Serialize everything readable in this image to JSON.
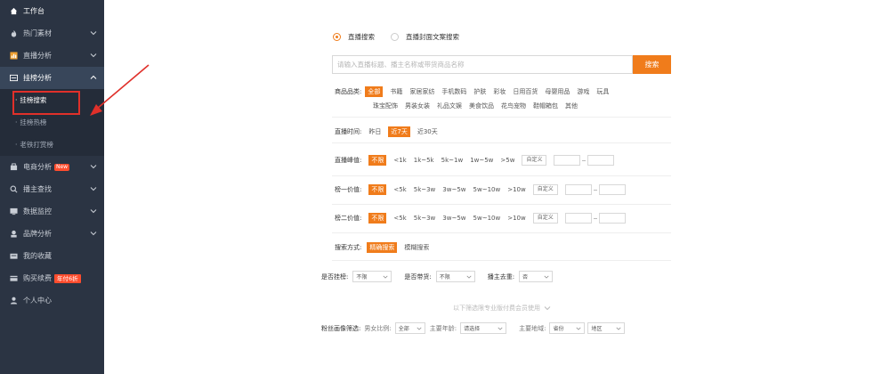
{
  "sidebar": {
    "items": [
      {
        "label": "工作台",
        "icon": "home-icon"
      },
      {
        "label": "热门素材",
        "icon": "fire-icon"
      },
      {
        "label": "直播分析",
        "icon": "bar-chart-icon"
      },
      {
        "label": "挂榜分析",
        "icon": "board-icon"
      },
      {
        "label": "电商分析",
        "icon": "shop-icon",
        "badge": "New"
      },
      {
        "label": "播主查找",
        "icon": "search-icon"
      },
      {
        "label": "数据监控",
        "icon": "monitor-icon"
      },
      {
        "label": "品牌分析",
        "icon": "brand-icon"
      },
      {
        "label": "我的收藏",
        "icon": "folder-icon"
      },
      {
        "label": "购买续费",
        "icon": "card-icon",
        "badge": "年付6折"
      },
      {
        "label": "个人中心",
        "icon": "user-icon"
      }
    ],
    "subitems": [
      {
        "label": "挂榜搜索"
      },
      {
        "label": "挂榜热榜"
      },
      {
        "label": "老铁打赏榜"
      }
    ]
  },
  "search": {
    "modes": [
      "直播搜索",
      "直播封面文案搜索"
    ],
    "placeholder": "请输入直播标题、播主名称或带货商品名称",
    "button": "搜索"
  },
  "filters": {
    "category": {
      "label": "商品品类:",
      "row1": [
        "全部",
        "书籍",
        "家居家纺",
        "手机数码",
        "护肤",
        "彩妆",
        "日用百货",
        "母婴用品",
        "游戏",
        "玩具"
      ],
      "row2": [
        "珠宝配饰",
        "男装女装",
        "礼品文娱",
        "美食饮品",
        "花鸟宠物",
        "鞋帽箱包",
        "其他"
      ]
    },
    "time": {
      "label": "直播时间:",
      "options": [
        "昨日",
        "近7天",
        "近30天"
      ]
    },
    "peak": {
      "label": "直播峰值:",
      "options": [
        "不限",
        "<1k",
        "1k~5k",
        "5k~1w",
        "1w~5w",
        ">5w"
      ],
      "custom": "自定义"
    },
    "rank1": {
      "label": "榜一价值:",
      "options": [
        "不限",
        "<5k",
        "5k~3w",
        "3w~5w",
        "5w~10w",
        ">10w"
      ],
      "custom": "自定义"
    },
    "rank2": {
      "label": "榜二价值:",
      "options": [
        "不限",
        "<5k",
        "5k~3w",
        "3w~5w",
        "5w~10w",
        ">10w"
      ],
      "custom": "自定义"
    },
    "method": {
      "label": "搜索方式:",
      "options": [
        "精确搜索",
        "模糊搜索"
      ]
    },
    "misc": {
      "hang_label": "是否挂榜:",
      "hang_value": "不限",
      "goods_label": "是否带货:",
      "goods_value": "不限",
      "dedup_label": "播主去重:",
      "dedup_value": "否"
    },
    "pro_hint": "以下筛选限专业版付费会员使用",
    "fans": {
      "label": "粉丝画像筛选:",
      "gender_label": "男女比例:",
      "gender_value": "全部",
      "age_label": "主要年龄:",
      "age_value": "请选择",
      "region_label": "主要地域:",
      "province_value": "省份",
      "district_value": "地区"
    }
  },
  "colors": {
    "accent": "#f07c1b",
    "sidebar_bg": "#2b3443",
    "highlight": "#e0302a"
  }
}
